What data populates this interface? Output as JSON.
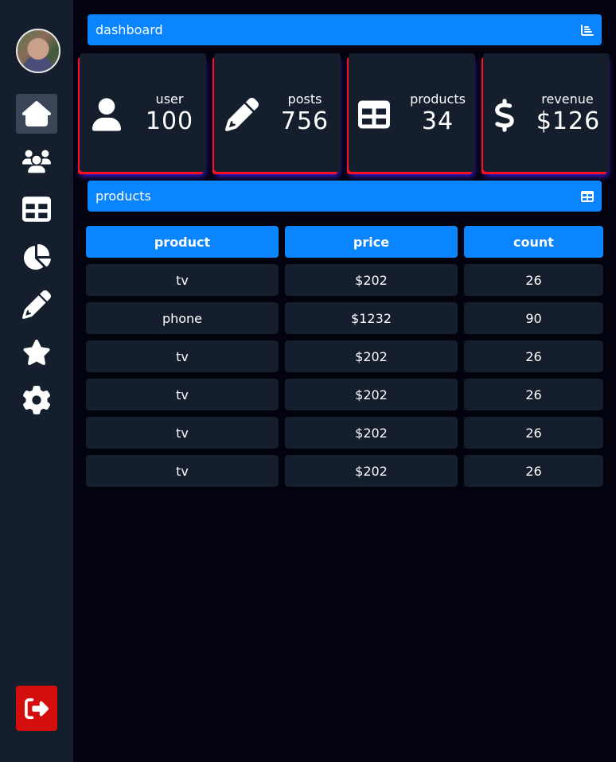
{
  "sidebar": {
    "avatar_icon": "user-photo",
    "items": [
      {
        "name": "home",
        "icon": "home-icon",
        "active": true
      },
      {
        "name": "users",
        "icon": "users-icon"
      },
      {
        "name": "table",
        "icon": "table-icon"
      },
      {
        "name": "chart",
        "icon": "pie-chart-icon"
      },
      {
        "name": "edit",
        "icon": "pencil-icon"
      },
      {
        "name": "favorites",
        "icon": "star-icon"
      },
      {
        "name": "settings",
        "icon": "gear-icon"
      }
    ],
    "logout_icon": "sign-out-icon"
  },
  "header": {
    "title": "dashboard",
    "icon": "bar-chart-icon"
  },
  "stats": [
    {
      "label": "user",
      "value": "100",
      "icon": "user-icon"
    },
    {
      "label": "posts",
      "value": "756",
      "icon": "pencil-icon"
    },
    {
      "label": "products",
      "value": "34",
      "icon": "table-icon"
    },
    {
      "label": "revenue",
      "value": "$126",
      "icon": "dollar-icon"
    }
  ],
  "products_section": {
    "title": "products",
    "icon": "table-icon"
  },
  "table": {
    "columns": [
      "product",
      "price",
      "count"
    ],
    "rows": [
      [
        "tv",
        "$202",
        "26"
      ],
      [
        "phone",
        "$1232",
        "90"
      ],
      [
        "tv",
        "$202",
        "26"
      ],
      [
        "tv",
        "$202",
        "26"
      ],
      [
        "tv",
        "$202",
        "26"
      ],
      [
        "tv",
        "$202",
        "26"
      ]
    ]
  },
  "colors": {
    "accent": "#0a85ff",
    "panel": "#141e2d",
    "background": "#03030f",
    "danger": "#d40d0d"
  }
}
